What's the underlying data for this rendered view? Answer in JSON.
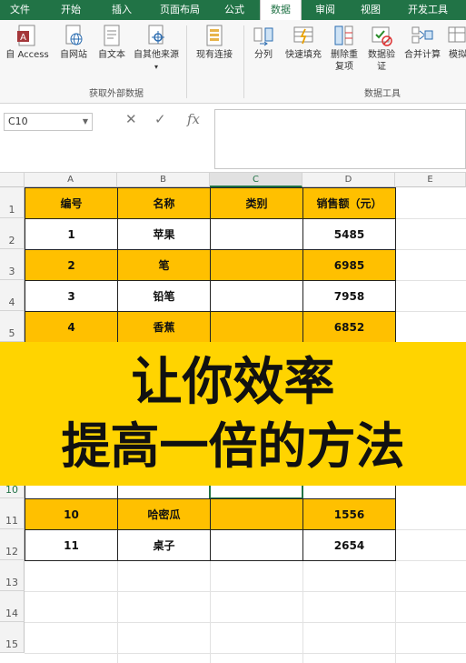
{
  "ribbon": {
    "tabs": [
      "文件",
      "开始",
      "插入",
      "页面布局",
      "公式",
      "数据",
      "审阅",
      "视图",
      "开发工具"
    ],
    "active_tab": "数据",
    "buttons_external": [
      "自 Access",
      "自网站",
      "自文本",
      "自其他来源",
      "现有连接"
    ],
    "group_external": "获取外部数据",
    "buttons_tools": [
      "分列",
      "快速填充",
      "删除重复项",
      "数据验证",
      "合并计算",
      "模拟"
    ],
    "group_tools": "数据工具"
  },
  "formula_bar": {
    "name_box": "C10",
    "cancel_symbol": "✕",
    "enter_symbol": "✓",
    "fx_symbol": "fx",
    "formula_value": ""
  },
  "grid": {
    "columns": [
      "A",
      "B",
      "C",
      "D",
      "E"
    ],
    "selected_column": "C",
    "rows": [
      "1",
      "2",
      "3",
      "4",
      "5",
      "10",
      "11",
      "12",
      "13",
      "14",
      "15"
    ],
    "selected_row": "10",
    "headers": [
      "编号",
      "名称",
      "类别",
      "销售额（元）"
    ],
    "data_rows": [
      {
        "no": "1",
        "name": "苹果",
        "category": "",
        "sales": "5485"
      },
      {
        "no": "2",
        "name": "笔",
        "category": "",
        "sales": "6985"
      },
      {
        "no": "3",
        "name": "铅笔",
        "category": "",
        "sales": "7958"
      },
      {
        "no": "4",
        "name": "香蕉",
        "category": "",
        "sales": "6852"
      },
      {
        "no": "10",
        "name": "哈密瓜",
        "category": "",
        "sales": "1556"
      },
      {
        "no": "11",
        "name": "桌子",
        "category": "",
        "sales": "2654"
      }
    ]
  },
  "banner": {
    "line1": "让你效率",
    "line2": "提高一倍的方法"
  },
  "colors": {
    "ribbon_green": "#217346",
    "header_orange": "#ffc000",
    "banner_yellow": "#ffd400"
  }
}
